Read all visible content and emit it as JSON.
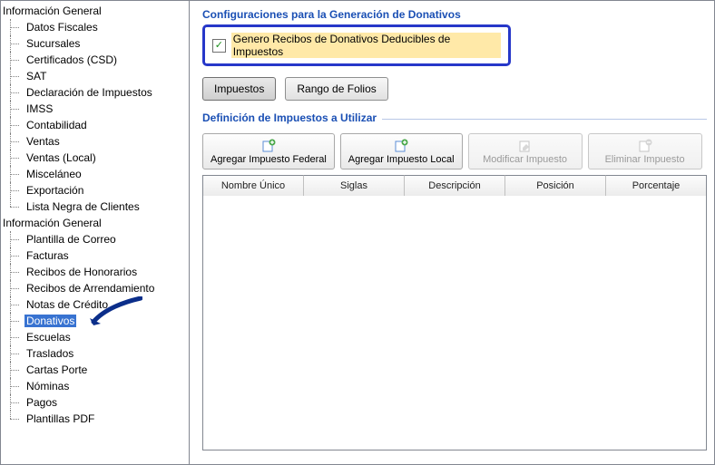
{
  "tree": {
    "group1_label": "Información General",
    "group1_items": [
      "Datos Fiscales",
      "Sucursales",
      "Certificados (CSD)",
      "SAT",
      "Declaración de Impuestos",
      "IMSS",
      "Contabilidad",
      "Ventas",
      "Ventas (Local)",
      "Misceláneo",
      "Exportación",
      "Lista Negra de Clientes"
    ],
    "group2_label": "Información General",
    "group2_items": [
      "Plantilla de Correo",
      "Facturas",
      "Recibos de Honorarios",
      "Recibos de Arrendamiento",
      "Notas de Crédito",
      "Donativos",
      "Escuelas",
      "Traslados",
      "Cartas Porte",
      "Nóminas",
      "Pagos",
      "Plantillas PDF"
    ],
    "selected": "Donativos"
  },
  "section": {
    "config_title": "Configuraciones para la Generación de Donativos",
    "checkbox_label": "Genero Recibos de Donativos Deducibles de Impuestos",
    "checkbox_checked": true
  },
  "tabs": {
    "impuestos": "Impuestos",
    "rango": "Rango de Folios"
  },
  "taxes": {
    "legend": "Definición de Impuestos a Utilizar",
    "buttons": {
      "add_federal": "Agregar Impuesto Federal",
      "add_local": "Agregar Impuesto Local",
      "modify": "Modificar Impuesto",
      "delete": "Eliminar Impuesto"
    },
    "columns": {
      "c1": "Nombre Único",
      "c2": "Siglas",
      "c3": "Descripción",
      "c4": "Posición",
      "c5": "Porcentaje"
    }
  }
}
